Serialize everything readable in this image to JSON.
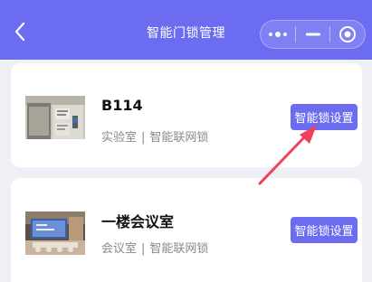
{
  "header": {
    "title": "智能门锁管理",
    "back_icon": "chevron-left-icon",
    "capsule": {
      "more_icon": "more-dots-icon",
      "minimize_icon": "minimize-icon",
      "close_icon": "target-circle-icon"
    }
  },
  "locks": [
    {
      "name": "B114",
      "category": "实验室",
      "separator": "|",
      "type": "智能联网锁",
      "button_label": "智能锁设置"
    },
    {
      "name": "一楼会议室",
      "category": "会议室",
      "separator": "|",
      "type": "智能联网锁",
      "button_label": "智能锁设置"
    }
  ],
  "annotation": {
    "arrow_color": "#f0405a"
  },
  "colors": {
    "accent": "#6b6cf0",
    "background": "#eef0f6",
    "card": "#ffffff",
    "muted_text": "#8a8a8a"
  }
}
